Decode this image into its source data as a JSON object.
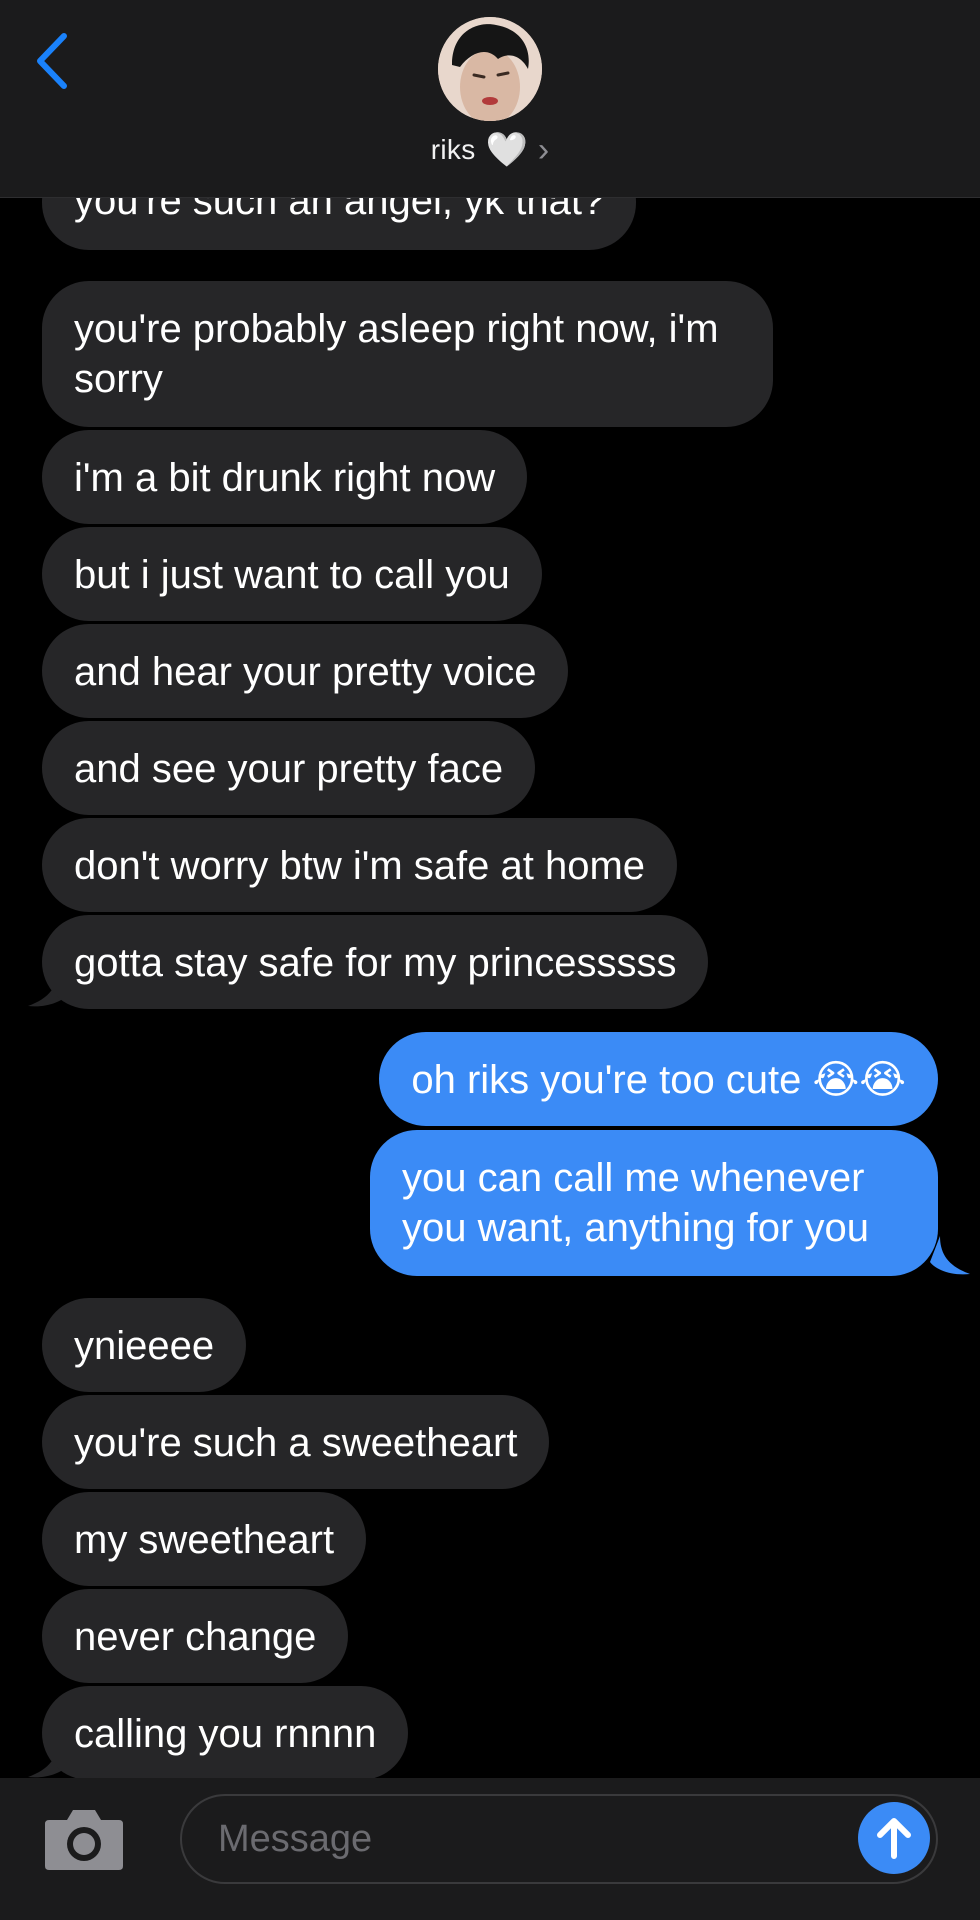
{
  "header": {
    "contact_name": "riks",
    "contact_heart": "🤍",
    "chevron": "›"
  },
  "messages": [
    {
      "dir": "in",
      "text": "you're such an angel, yk that?"
    },
    {
      "dir": "in",
      "text": "you're probably asleep right now, i'm sorry"
    },
    {
      "dir": "in",
      "text": "i'm a bit drunk right now"
    },
    {
      "dir": "in",
      "text": "but i just want to call you"
    },
    {
      "dir": "in",
      "text": "and hear your pretty voice"
    },
    {
      "dir": "in",
      "text": "and see your pretty face"
    },
    {
      "dir": "in",
      "text": "don't worry btw i'm safe at home"
    },
    {
      "dir": "in",
      "text": "gotta stay safe for my princesssss"
    },
    {
      "dir": "out",
      "text": "oh riks you're too cute 😭😭"
    },
    {
      "dir": "out",
      "text": "you can call me whenever you want, anything for you"
    },
    {
      "dir": "in",
      "text": "ynieeee"
    },
    {
      "dir": "in",
      "text": "you're such a sweetheart"
    },
    {
      "dir": "in",
      "text": "my sweetheart"
    },
    {
      "dir": "in",
      "text": "never change"
    },
    {
      "dir": "in",
      "text": "calling you rnnnn"
    }
  ],
  "composer": {
    "placeholder": "Message"
  },
  "colors": {
    "incoming_bubble": "#262628",
    "outgoing_bubble": "#3b8bf6",
    "accent": "#1a82fb",
    "bar_background": "#1b1b1c"
  },
  "icons": [
    "back-chevron-icon",
    "camera-icon",
    "send-arrow-icon"
  ]
}
